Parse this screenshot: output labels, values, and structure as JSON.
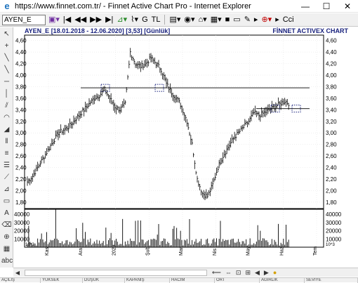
{
  "window": {
    "title": "https://www.finnet.com.tr/ - Finnet Active Chart Pro - Internet Explorer",
    "minimize": "—",
    "maximize": "☐",
    "close": "✕"
  },
  "toolbar": {
    "symbol": "AYEN_E",
    "g_label": "G",
    "tl_label": "TL",
    "cci_label": "Cci"
  },
  "chart": {
    "header_left": "AYEN_E [18.01.2018 - 12.06.2020] [3,53] [Günlük]",
    "header_right": "FİNNET ACTIVEX CHART",
    "price_ticks": [
      "4,60",
      "4,40",
      "4,20",
      "4,00",
      "3,80",
      "3,60",
      "3,40",
      "3,20",
      "3,00",
      "2,80",
      "2,60",
      "2,40",
      "2,20",
      "2,00",
      "1,80"
    ],
    "volume_ticks": [
      "40000",
      "30000",
      "20000",
      "10000"
    ],
    "volume_unit": "10^3",
    "x_labels": [
      "Kas",
      "Ara",
      "2020",
      "Şub",
      "Mar",
      "Nis",
      "May",
      "Haz",
      "Tem"
    ],
    "accent": "#1a237e"
  },
  "chart_data": {
    "type": "candlestick-ohlc",
    "title": "AYEN_E [18.01.2018 - 12.06.2020] [3,53] [Günlük]",
    "x": [
      "Kas",
      "Ara",
      "2020",
      "Şub",
      "Mar",
      "Nis",
      "May",
      "Haz",
      "Tem"
    ],
    "ylim": [
      1.75,
      4.62
    ],
    "price_close_path": [
      2.15,
      2.25,
      2.4,
      2.55,
      2.7,
      2.85,
      3.0,
      3.05,
      3.1,
      3.2,
      3.3,
      3.4,
      3.5,
      3.6,
      3.65,
      3.75,
      3.6,
      3.45,
      3.4,
      3.5,
      4.4,
      4.2,
      4.15,
      4.2,
      4.3,
      4.2,
      4.1,
      3.85,
      3.7,
      3.6,
      3.45,
      3.2,
      2.8,
      2.2,
      1.95,
      1.9,
      2.1,
      2.4,
      2.6,
      2.75,
      2.9,
      3.0,
      3.1,
      3.2,
      3.35,
      3.3,
      3.35,
      3.4,
      3.45,
      3.5,
      3.55,
      3.5
    ],
    "horizontal_lines": [
      3.78,
      3.42
    ],
    "volume_ylim": [
      0,
      47000
    ]
  },
  "statusbar": {
    "cells": [
      "AÇILIŞ",
      "YÜKSEK",
      "DÜŞÜK",
      "KAPANIŞ",
      "HACİM",
      "ORT",
      "AĞIRLIK",
      "SEVİYE"
    ]
  }
}
